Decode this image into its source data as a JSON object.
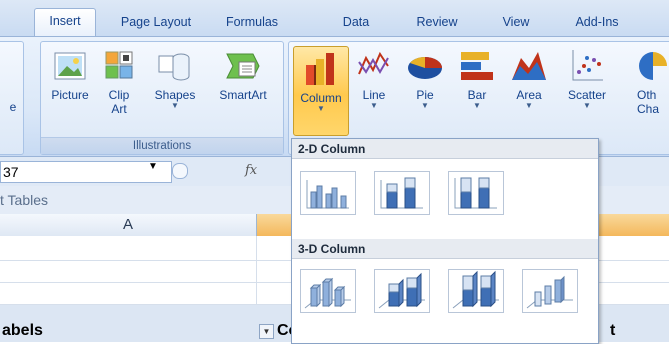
{
  "tabs": [
    "Insert",
    "Page Layout",
    "Formulas",
    "Data",
    "Review",
    "View",
    "Add-Ins"
  ],
  "ribbon": {
    "left_cut_label": "e",
    "illustrations": {
      "title": "Illustrations",
      "buttons": [
        {
          "label": "Picture",
          "icon": "picture-icon"
        },
        {
          "label": "Clip",
          "label2": "Art",
          "icon": "clip-art-icon"
        },
        {
          "label": "Shapes",
          "icon": "shapes-icon"
        },
        {
          "label": "SmartArt",
          "icon": "smartart-icon"
        }
      ]
    },
    "charts": {
      "buttons": [
        {
          "label": "Column",
          "icon": "column-chart-icon",
          "selected": true
        },
        {
          "label": "Line",
          "icon": "line-chart-icon"
        },
        {
          "label": "Pie",
          "icon": "pie-chart-icon"
        },
        {
          "label": "Bar",
          "icon": "bar-chart-icon"
        },
        {
          "label": "Area",
          "icon": "area-chart-icon"
        },
        {
          "label": "Scatter",
          "icon": "scatter-chart-icon"
        },
        {
          "label": "Oth",
          "label2": "Cha",
          "icon": "other-charts-icon"
        }
      ]
    }
  },
  "formula_bar": {
    "name_box": "37",
    "fx": "fx"
  },
  "pivot_bar": {
    "label": "t Tables"
  },
  "sheet": {
    "col_a": "A",
    "row_labels_text": "abels",
    "col_b_text": "Co",
    "col_t_text": "t"
  },
  "gallery": {
    "sections": [
      "2-D Column",
      "3-D Column"
    ]
  },
  "colors": {
    "selected": "#ffc94d",
    "ribbon": "#dbe8f8",
    "text": "#15428b"
  }
}
